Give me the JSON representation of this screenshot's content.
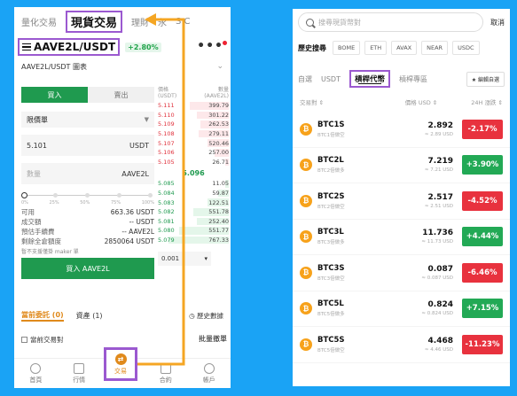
{
  "left": {
    "top_tabs": [
      "量化交易",
      "現貨交易",
      "理財",
      "永",
      "S C"
    ],
    "pair": "AAVE2L/USDT",
    "pair_change": "+2.80%",
    "chart_label": "AAVE2L/USDT 圖表",
    "buy_tab": "買入",
    "sell_tab": "賣出",
    "order_type": "限價單",
    "price_value": "5.101",
    "price_unit": "USDT",
    "qty_placeholder": "數量",
    "qty_unit": "AAVE2L",
    "slider_labels": [
      "0%",
      "25%",
      "50%",
      "75%",
      "100%"
    ],
    "slider_level": 0,
    "info": [
      {
        "label": "可用",
        "value": "663.36 USDT"
      },
      {
        "label": "成交額",
        "value": "-- USDT"
      },
      {
        "label": "預估手續費",
        "value": "-- AAVE2L"
      },
      {
        "label": "剩餘全倉額度",
        "value": "2850064 USDT"
      }
    ],
    "no_maker": "暫不支援僅掛 maker 單",
    "buy_button": "買入 AAVE2L",
    "book_head": {
      "price": "價格",
      "price_unit": "(USDT)",
      "qty": "數量",
      "qty_unit": "(AAVE2L)"
    },
    "asks": [
      {
        "p": "5.111",
        "q": "399.79",
        "depth": 0.55
      },
      {
        "p": "5.110",
        "q": "301.22",
        "depth": 0.45
      },
      {
        "p": "5.109",
        "q": "262.53",
        "depth": 0.4
      },
      {
        "p": "5.108",
        "q": "279.11",
        "depth": 0.42
      },
      {
        "p": "5.107",
        "q": "520.46",
        "depth": 0.3
      },
      {
        "p": "5.106",
        "q": "257.00",
        "depth": 0.2
      },
      {
        "p": "5.105",
        "q": "26.71",
        "depth": 0.05
      }
    ],
    "mid_price": "5.096",
    "bids": [
      {
        "p": "5.085",
        "q": "11.05",
        "depth": 0.05
      },
      {
        "p": "5.084",
        "q": "59.87",
        "depth": 0.15
      },
      {
        "p": "5.083",
        "q": "122.51",
        "depth": 0.3
      },
      {
        "p": "5.082",
        "q": "551.78",
        "depth": 0.5
      },
      {
        "p": "5.081",
        "q": "252.40",
        "depth": 0.45
      },
      {
        "p": "5.080",
        "q": "551.77",
        "depth": 0.7
      },
      {
        "p": "5.079",
        "q": "767.33",
        "depth": 0.85
      }
    ],
    "depth_select": "0.001",
    "orders_tab_active": "當前委託 (0)",
    "orders_tab_assets": "資產 (1)",
    "history": "歷史數據",
    "current_pair": "當前交易對",
    "bulk_cancel": "批量撤單",
    "nav": [
      "首頁",
      "行情",
      "交易",
      "合約",
      "帳戶"
    ],
    "colors": {
      "buy": "#1f9a4f",
      "sell": "#e0303b",
      "accent": "#e08a1c",
      "highlight": "#9b59d0"
    }
  },
  "right": {
    "search_placeholder": "搜尋現貨幣對",
    "cancel": "取消",
    "history_label": "歷史搜尋",
    "history_chips": [
      "BOME",
      "ETH",
      "AVAX",
      "NEAR",
      "USDC"
    ],
    "sub_tabs": [
      "自選",
      "USDT",
      "槓桿代幣",
      "槓桿專區"
    ],
    "active_sub_tab": "槓桿代幣",
    "edit_fav": "★ 編輯自選",
    "list_head": {
      "pair": "交易對 ⇕",
      "price": "價格 USD ⇕",
      "change": "24H 漲跌 ⇕"
    },
    "coins": [
      {
        "sym": "BTC1S",
        "sub": "BTC1倍做空",
        "price": "2.892",
        "price_sub": "≈ 2.89 USD",
        "change": "-2.17%",
        "dir": "down"
      },
      {
        "sym": "BTC2L",
        "sub": "BTC2倍做多",
        "price": "7.219",
        "price_sub": "≈ 7.21 USD",
        "change": "+3.90%",
        "dir": "up"
      },
      {
        "sym": "BTC2S",
        "sub": "BTC2倍做空",
        "price": "2.517",
        "price_sub": "≈ 2.51 USD",
        "change": "-4.52%",
        "dir": "down"
      },
      {
        "sym": "BTC3L",
        "sub": "BTC3倍做多",
        "price": "11.736",
        "price_sub": "≈ 11.73 USD",
        "change": "+4.44%",
        "dir": "up"
      },
      {
        "sym": "BTC3S",
        "sub": "BTC3倍做空",
        "price": "0.087",
        "price_sub": "≈ 0.087 USD",
        "change": "-6.46%",
        "dir": "down"
      },
      {
        "sym": "BTC5L",
        "sub": "BTC5倍做多",
        "price": "0.824",
        "price_sub": "≈ 0.824 USD",
        "change": "+7.15%",
        "dir": "up"
      },
      {
        "sym": "BTC5S",
        "sub": "BTC5倍做空",
        "price": "4.468",
        "price_sub": "≈ 4.46 USD",
        "change": "-11.23%",
        "dir": "down"
      }
    ]
  }
}
